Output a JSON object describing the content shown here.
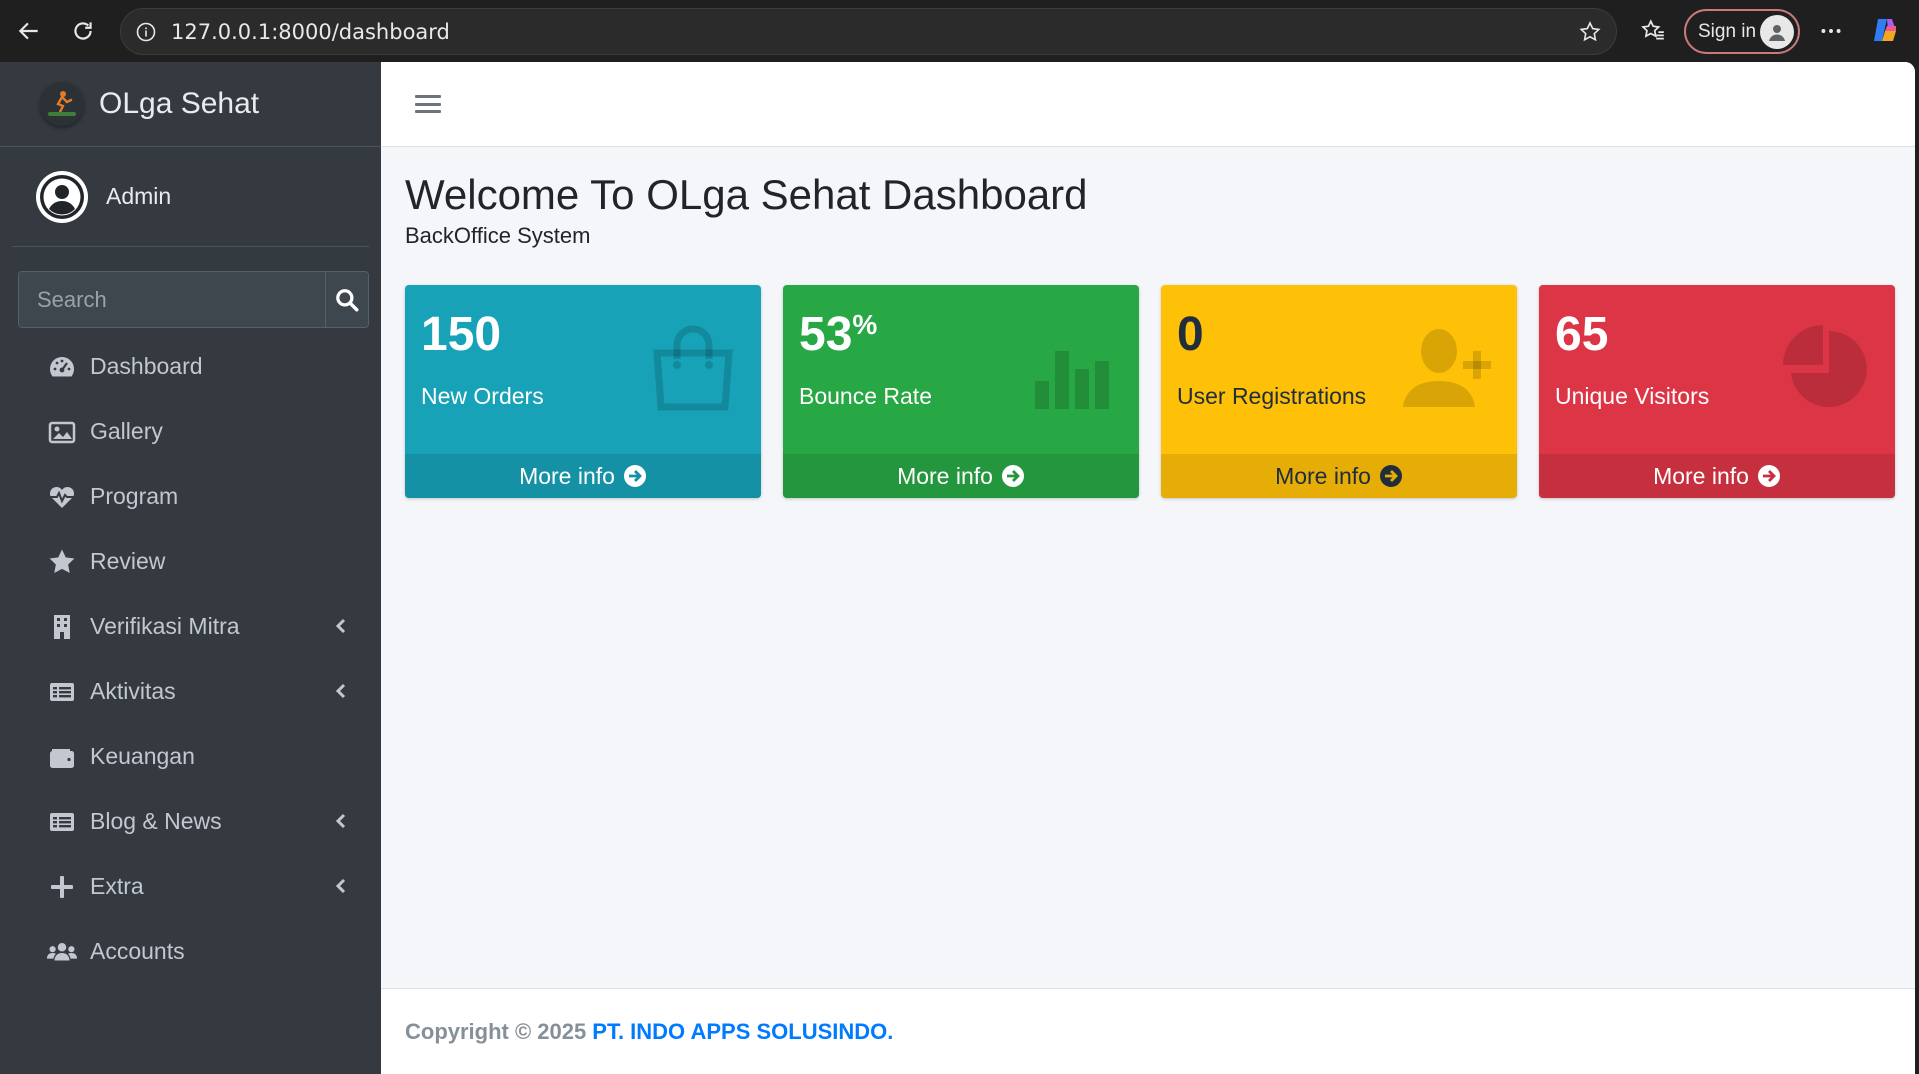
{
  "browser": {
    "url": "127.0.0.1:8000/dashboard",
    "signin_label": "Sign in"
  },
  "sidebar": {
    "brand": "OLga Sehat",
    "user": "Admin",
    "search_placeholder": "Search",
    "items": [
      {
        "label": "Dashboard",
        "icon": "tachometer-icon"
      },
      {
        "label": "Gallery",
        "icon": "image-icon"
      },
      {
        "label": "Program",
        "icon": "heartbeat-icon"
      },
      {
        "label": "Review",
        "icon": "star-icon"
      },
      {
        "label": "Verifikasi Mitra",
        "icon": "building-icon",
        "has_submenu": true
      },
      {
        "label": "Aktivitas",
        "icon": "list-icon",
        "has_submenu": true
      },
      {
        "label": "Keuangan",
        "icon": "wallet-icon"
      },
      {
        "label": "Blog & News",
        "icon": "newspaper-icon",
        "has_submenu": true
      },
      {
        "label": "Extra",
        "icon": "plus-icon",
        "has_submenu": true
      },
      {
        "label": "Accounts",
        "icon": "users-icon"
      }
    ]
  },
  "main": {
    "title": "Welcome To OLga Sehat Dashboard",
    "subtitle": "BackOffice System",
    "cards": [
      {
        "value": "150",
        "suffix": "",
        "label": "New Orders",
        "more": "More info",
        "color": "#17a2b8",
        "icon": "shopping-bag-icon"
      },
      {
        "value": "53",
        "suffix": "%",
        "label": "Bounce Rate",
        "more": "More info",
        "color": "#28a745",
        "icon": "bar-chart-icon"
      },
      {
        "value": "0",
        "suffix": "",
        "label": "User Registrations",
        "more": "More info",
        "color": "#ffc107",
        "icon": "user-plus-icon"
      },
      {
        "value": "65",
        "suffix": "",
        "label": "Unique Visitors",
        "more": "More info",
        "color": "#dc3545",
        "icon": "pie-chart-icon"
      }
    ]
  },
  "footer": {
    "copyright": "Copyright © 2025",
    "company": "PT. INDO APPS SOLUSINDO."
  }
}
